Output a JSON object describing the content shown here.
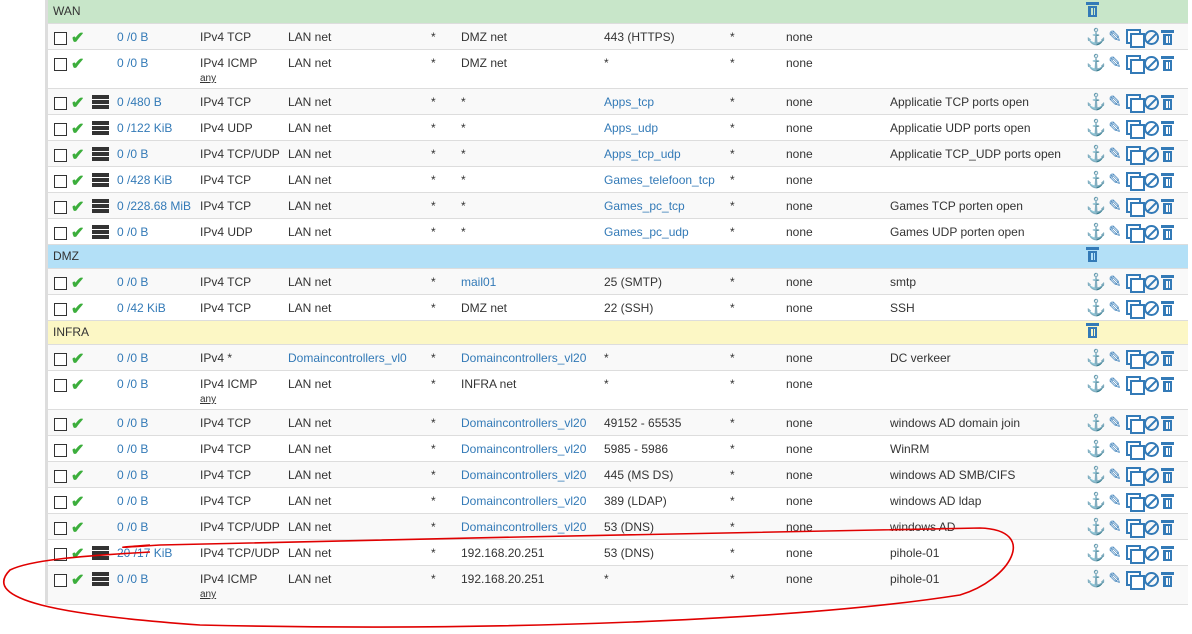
{
  "colors": {
    "WAN": "#c8e6c9",
    "DMZ": "#b3e0f7",
    "INFRA": "#fcf7c5",
    "accent": "#337ab7",
    "pass": "#3cae3c",
    "annotation": "#e00000"
  },
  "rows": [
    {
      "section": "WAN"
    },
    {
      "states": "0 /0 B",
      "proto": "IPv4 TCP",
      "src": "LAN net",
      "sport": "*",
      "dst": "DMZ net",
      "dport": "443 (HTTPS)",
      "gw": "*",
      "queue": "none",
      "desc": ""
    },
    {
      "states": "0 /0 B",
      "proto": "IPv4 ICMP",
      "sub": "any",
      "src": "LAN net",
      "sport": "*",
      "dst": "DMZ net",
      "dport": "*",
      "gw": "*",
      "queue": "none",
      "desc": ""
    },
    {
      "q": true,
      "states": "0 /480 B",
      "proto": "IPv4 TCP",
      "src": "LAN net",
      "sport": "*",
      "dst": "*",
      "dport": "Apps_tcp",
      "dportLink": true,
      "gw": "*",
      "queue": "none",
      "desc": "Applicatie TCP ports open"
    },
    {
      "q": true,
      "states": "0 /122 KiB",
      "proto": "IPv4 UDP",
      "src": "LAN net",
      "sport": "*",
      "dst": "*",
      "dport": "Apps_udp",
      "dportLink": true,
      "gw": "*",
      "queue": "none",
      "desc": "Applicatie UDP ports open"
    },
    {
      "q": true,
      "states": "0 /0 B",
      "proto": "IPv4 TCP/UDP",
      "src": "LAN net",
      "sport": "*",
      "dst": "*",
      "dport": "Apps_tcp_udp",
      "dportLink": true,
      "gw": "*",
      "queue": "none",
      "desc": "Applicatie TCP_UDP ports open"
    },
    {
      "q": true,
      "states": "0 /428 KiB",
      "proto": "IPv4 TCP",
      "src": "LAN net",
      "sport": "*",
      "dst": "*",
      "dport": "Games_telefoon_tcp",
      "dportLink": true,
      "gw": "*",
      "queue": "none",
      "desc": ""
    },
    {
      "q": true,
      "states": "0 /228.68 MiB",
      "proto": "IPv4 TCP",
      "src": "LAN net",
      "sport": "*",
      "dst": "*",
      "dport": "Games_pc_tcp",
      "dportLink": true,
      "gw": "*",
      "queue": "none",
      "desc": "Games TCP porten open"
    },
    {
      "q": true,
      "states": "0 /0 B",
      "proto": "IPv4 UDP",
      "src": "LAN net",
      "sport": "*",
      "dst": "*",
      "dport": "Games_pc_udp",
      "dportLink": true,
      "gw": "*",
      "queue": "none",
      "desc": "Games UDP porten open"
    },
    {
      "section": "DMZ"
    },
    {
      "states": "0 /0 B",
      "proto": "IPv4 TCP",
      "src": "LAN net",
      "sport": "*",
      "dst": "mail01",
      "dstLink": true,
      "dport": "25 (SMTP)",
      "gw": "*",
      "queue": "none",
      "desc": "smtp"
    },
    {
      "states": "0 /42 KiB",
      "proto": "IPv4 TCP",
      "src": "LAN net",
      "sport": "*",
      "dst": "DMZ net",
      "dport": "22 (SSH)",
      "gw": "*",
      "queue": "none",
      "desc": "SSH"
    },
    {
      "section": "INFRA"
    },
    {
      "states": "0 /0 B",
      "proto": "IPv4 *",
      "src": "Domaincontrollers_vl0",
      "srcLink": true,
      "sport": "*",
      "dst": "Domaincontrollers_vl20",
      "dstLink": true,
      "dport": "*",
      "gw": "*",
      "queue": "none",
      "desc": "DC verkeer"
    },
    {
      "states": "0 /0 B",
      "proto": "IPv4 ICMP",
      "sub": "any",
      "src": "LAN net",
      "sport": "*",
      "dst": "INFRA net",
      "dport": "*",
      "gw": "*",
      "queue": "none",
      "desc": ""
    },
    {
      "states": "0 /0 B",
      "proto": "IPv4 TCP",
      "src": "LAN net",
      "sport": "*",
      "dst": "Domaincontrollers_vl20",
      "dstLink": true,
      "dport": "49152 - 65535",
      "gw": "*",
      "queue": "none",
      "desc": "windows AD domain join"
    },
    {
      "states": "0 /0 B",
      "proto": "IPv4 TCP",
      "src": "LAN net",
      "sport": "*",
      "dst": "Domaincontrollers_vl20",
      "dstLink": true,
      "dport": "5985 - 5986",
      "gw": "*",
      "queue": "none",
      "desc": "WinRM"
    },
    {
      "states": "0 /0 B",
      "proto": "IPv4 TCP",
      "src": "LAN net",
      "sport": "*",
      "dst": "Domaincontrollers_vl20",
      "dstLink": true,
      "dport": "445 (MS DS)",
      "gw": "*",
      "queue": "none",
      "desc": "windows AD SMB/CIFS"
    },
    {
      "states": "0 /0 B",
      "proto": "IPv4 TCP",
      "src": "LAN net",
      "sport": "*",
      "dst": "Domaincontrollers_vl20",
      "dstLink": true,
      "dport": "389 (LDAP)",
      "gw": "*",
      "queue": "none",
      "desc": "windows AD ldap"
    },
    {
      "states": "0 /0 B",
      "proto": "IPv4 TCP/UDP",
      "src": "LAN net",
      "sport": "*",
      "dst": "Domaincontrollers_vl20",
      "dstLink": true,
      "dport": "53 (DNS)",
      "gw": "*",
      "queue": "none",
      "desc": "windows AD"
    },
    {
      "q": true,
      "states": "20 /17 KiB",
      "proto": "IPv4 TCP/UDP",
      "src": "LAN net",
      "sport": "*",
      "dst": "192.168.20.251",
      "dport": "53 (DNS)",
      "gw": "*",
      "queue": "none",
      "desc": "pihole-01"
    },
    {
      "q": true,
      "states": "0 /0 B",
      "proto": "IPv4 ICMP",
      "sub": "any",
      "src": "LAN net",
      "sport": "*",
      "dst": "192.168.20.251",
      "dport": "*",
      "gw": "*",
      "queue": "none",
      "desc": "pihole-01"
    }
  ]
}
